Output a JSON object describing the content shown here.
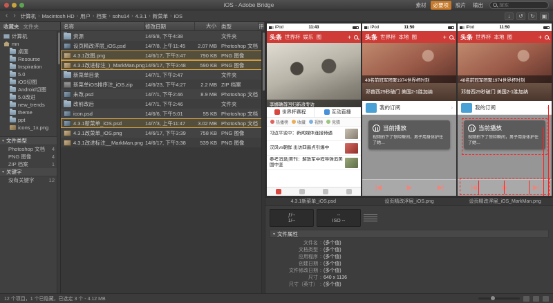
{
  "window": {
    "title": "iOS - Adobe Bridge"
  },
  "palette": {
    "accent_orange": "#c77a29",
    "selection_border": "#cf9d43",
    "app_red": "#cf3c38",
    "annotation_red": "#ff1f1f"
  },
  "pathbar": {
    "crumbs": [
      "计算机",
      "Macintosh HD",
      "用户",
      "档案",
      "sohu14",
      "4.3.1",
      "新菜单",
      "iOS"
    ],
    "workspaces": [
      "素材",
      "必要项",
      "胶片",
      "输出"
    ],
    "active_workspace": "必要项",
    "search_placeholder": "搜索"
  },
  "sidebar": {
    "tabs": [
      "收藏夹",
      "文件夹"
    ],
    "tree": [
      {
        "label": "计算机",
        "icon": "computer",
        "depth": 0
      },
      {
        "label": "mn",
        "icon": "home",
        "depth": 0
      },
      {
        "label": "桌面",
        "icon": "folder",
        "depth": 1
      },
      {
        "label": "Resourse",
        "icon": "folder",
        "depth": 1
      },
      {
        "label": "Inspiration",
        "icon": "folder",
        "depth": 1
      },
      {
        "label": "5.0",
        "icon": "folder",
        "depth": 1
      },
      {
        "label": "iOS切图",
        "icon": "folder",
        "depth": 1
      },
      {
        "label": "Android切图",
        "icon": "folder",
        "depth": 1
      },
      {
        "label": "5.0改进",
        "icon": "folder",
        "depth": 1
      },
      {
        "label": "new_trends",
        "icon": "folder",
        "depth": 1
      },
      {
        "label": "theme",
        "icon": "folder",
        "depth": 1
      },
      {
        "label": "ppt",
        "icon": "folder",
        "depth": 1
      },
      {
        "label": "icons_1x.png",
        "icon": "image",
        "depth": 1
      }
    ],
    "filters": [
      {
        "title": "文件类型",
        "items": [
          {
            "label": "Photoshop 文档",
            "count": "4"
          },
          {
            "label": "PNG 图像",
            "count": "4"
          },
          {
            "label": "ZIP 档案",
            "count": "1"
          }
        ]
      },
      {
        "title": "关键字",
        "items": [
          {
            "label": "没有关键字",
            "count": "12"
          }
        ]
      }
    ]
  },
  "filelist": {
    "columns": [
      "名称",
      "修改日期",
      "大小",
      "类型",
      "评级"
    ],
    "rows": [
      {
        "name": "资源",
        "date": "14/6/8, 下午4:38",
        "size": "",
        "type": "文件夹",
        "icon": "folder",
        "selected": false
      },
      {
        "name": "设页精改浮层_iOS.psd",
        "date": "14/7/8, 上午11:45",
        "size": "2.07 MB",
        "type": "Photoshop 文档",
        "icon": "psd",
        "selected": false
      },
      {
        "name": "4.3.1改图.png",
        "date": "14/6/17, 下午3:47",
        "size": "790 KB",
        "type": "PNG 图像",
        "icon": "image",
        "selected": true
      },
      {
        "name": "4.3.1改进标注_)_MarkMan.png",
        "date": "14/6/17, 下午3:48",
        "size": "590 KB",
        "type": "PNG 图像",
        "icon": "image",
        "selected": true
      },
      {
        "name": "新菜单目录",
        "date": "14/7/1, 下午2:47",
        "size": "",
        "type": "文件夹",
        "icon": "folder",
        "selected": false
      },
      {
        "name": "新菜单iOS排序注_iOS.zip",
        "date": "14/6/23, 下午4:27",
        "size": "2.2 MB",
        "type": "ZIP 档案",
        "icon": "zip",
        "selected": false
      },
      {
        "name": "未改.psd",
        "date": "14/7/1, 下午2:46",
        "size": "8.9 MB",
        "type": "Photoshop 文档",
        "icon": "psd",
        "selected": false
      },
      {
        "name": "改前改后",
        "date": "14/7/1, 下午2:46",
        "size": "",
        "type": "文件夹",
        "icon": "folder",
        "selected": false
      },
      {
        "name": "icon.psd",
        "date": "14/6/6, 下午5:01",
        "size": "55 KB",
        "type": "Photoshop 文档",
        "icon": "psd",
        "selected": false
      },
      {
        "name": "4.3.1新菜单_iOS.psd",
        "date": "14/7/3, 上午11:47",
        "size": "3.02 MB",
        "type": "Photoshop 文档",
        "icon": "psd",
        "selected": true
      },
      {
        "name": "4.3.1改菜单_iOS.png",
        "date": "14/6/17, 下午3:39",
        "size": "758 KB",
        "type": "PNG 图像",
        "icon": "image",
        "selected": false
      },
      {
        "name": "4.3.1改进标注__MarkMan.png",
        "date": "14/6/17, 下午3:38",
        "size": "539 KB",
        "type": "PNG 图像",
        "icon": "image",
        "selected": false
      }
    ]
  },
  "previews": {
    "labels": [
      "4.3.1新菜单_iOS.psd",
      "设页精改浮层_iOS.png",
      "设页精改浮层_iOS_MarkMan.png"
    ]
  },
  "phones": [
    {
      "carrier": "iPod",
      "time": "11:43",
      "app_title": "头条",
      "tabs": [
        "世界杯",
        "娱乐",
        "图"
      ],
      "hero_caption": "李娜确首回归新浪专访",
      "cells": [
        "世界杯赛程",
        "互动直播"
      ],
      "chips": [
        "热播榜",
        "收藏",
        "视频",
        "竞猜"
      ],
      "news": [
        "习近平谈中：新闻媒体连接待遇",
        "汉风vs朝鲜 出访四霸点引爆中",
        "参考消息|美刊：解放军中程导弹追美国中坚"
      ]
    },
    {
      "carrier": "iPod",
      "time": "11:50",
      "app_title": "头条",
      "tabs": [
        "世界杯",
        "本地",
        "图"
      ],
      "hero_caption": "48名前冠军团聚1974世界杯时刻",
      "headline": "邓普西29秒破门 美国2-1胜加纳",
      "subscribe": "我的订阅",
      "now_playing": "当前播放",
      "now_text": "视频拍下了惊险瞬间，男子用身体护住了她…"
    },
    {
      "carrier": "iPod",
      "time": "11:50",
      "app_title": "头条",
      "tabs": [
        "世界杯",
        "本地",
        "图"
      ],
      "hero_caption": "48名前冠军团聚1974世界杯时刻",
      "headline": "邓普西29秒破门 美国2-1胜加纳",
      "subscribe": "我的订阅",
      "now_playing": "当前播放",
      "now_text": "视频拍下了惊险瞬间，男子用身体护住了她…"
    }
  ],
  "metadata": {
    "placard": {
      "f": "ƒ/--",
      "shutter": "1/--",
      "awb": "--",
      "iso": "ISO --"
    },
    "section_title": "文件属性",
    "rows": [
      {
        "label": "文件名",
        "value": "(多个值)"
      },
      {
        "label": "文档类型",
        "value": "(多个值)"
      },
      {
        "label": "应用程序",
        "value": "(多个值)"
      },
      {
        "label": "创建日期",
        "value": "(多个值)"
      },
      {
        "label": "文件修改日期",
        "value": "(多个值)"
      },
      {
        "label": "尺寸",
        "value": "640 x 1136"
      },
      {
        "label": "尺寸（英寸）",
        "value": "(多个值)"
      }
    ]
  },
  "statusbar": {
    "text": "12 个项目，1 个已隐藏，已选定 3 个 - 4.12 MB"
  }
}
